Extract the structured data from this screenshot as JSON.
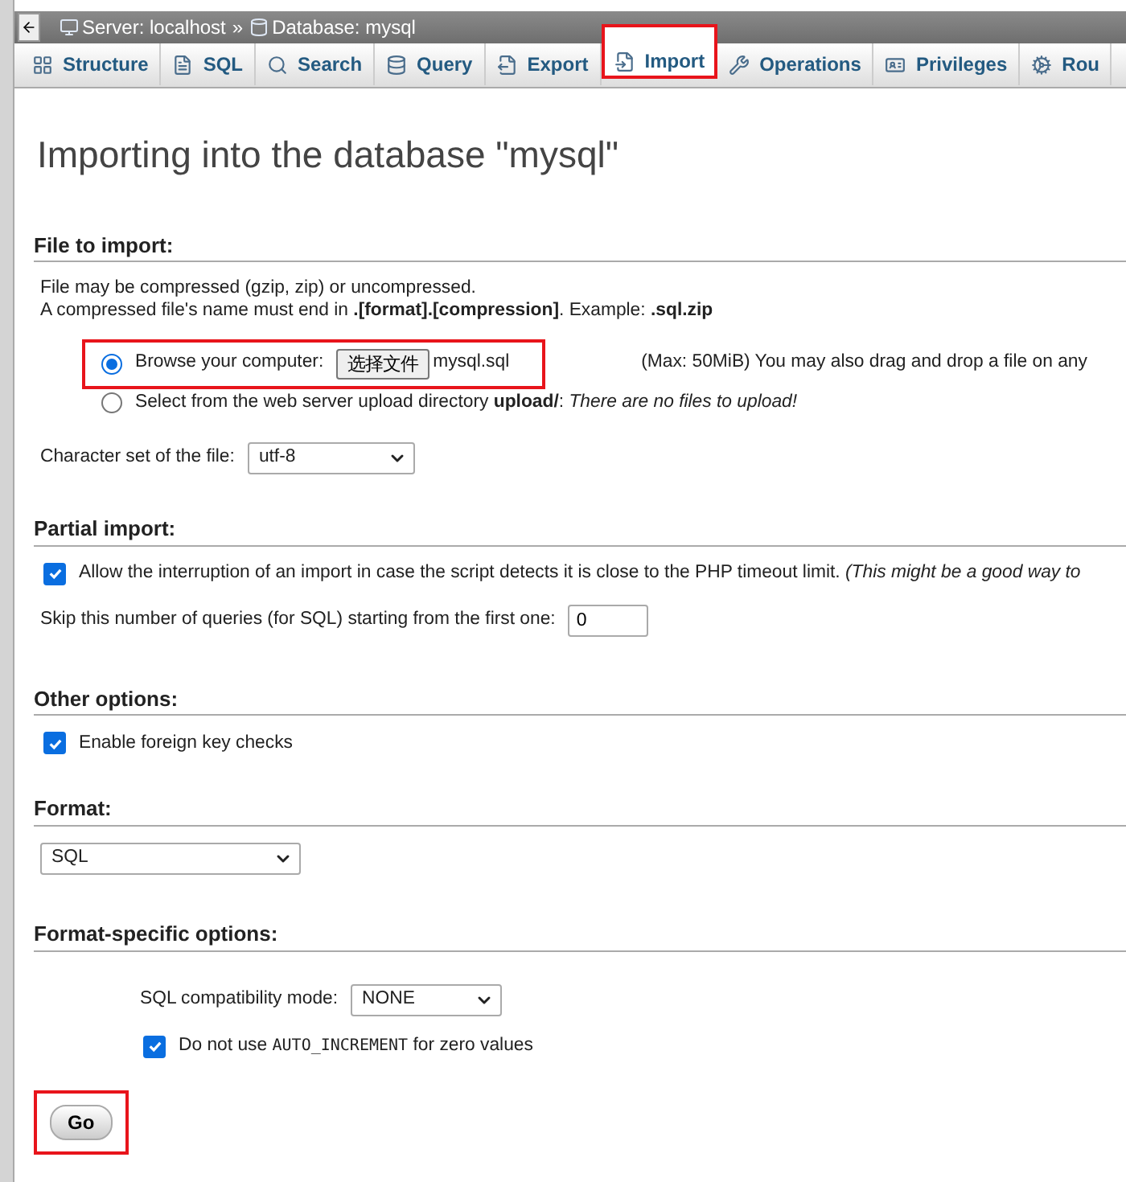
{
  "breadcrumb": [
    {
      "label": "Server: localhost",
      "kind": "server"
    },
    {
      "label": "Database: mysql",
      "kind": "database"
    }
  ],
  "breadcrumb_separator": "»",
  "tabs": [
    {
      "label": "Structure",
      "selected": false,
      "highlighted": false
    },
    {
      "label": "SQL",
      "selected": false,
      "highlighted": false
    },
    {
      "label": "Search",
      "selected": false,
      "highlighted": false
    },
    {
      "label": "Query",
      "selected": false,
      "highlighted": false
    },
    {
      "label": "Export",
      "selected": false,
      "highlighted": false
    },
    {
      "label": "Import",
      "selected": true,
      "highlighted": true
    },
    {
      "label": "Operations",
      "selected": false,
      "highlighted": false
    },
    {
      "label": "Privileges",
      "selected": false,
      "highlighted": false
    },
    {
      "label": "Rou",
      "selected": false,
      "highlighted": false
    }
  ],
  "title": "Importing into the database \"mysql\"",
  "file_section": {
    "heading": "File to import:",
    "notes": [
      "File may be compressed (gzip, zip) or uncompressed.",
      "A compressed file's name must end in **.[format].[compression]**. Example: **.sql.zip**"
    ],
    "sources": [
      {
        "label": "Browse your computer:",
        "selected": true,
        "highlighted": true,
        "button": "选择文件",
        "file": "mysql.sql",
        "hint": "(Max: 50MiB) You may also drag and drop a file on any"
      },
      {
        "label": "Select from the web server upload directory **upload/**: *There are no files to upload!*",
        "selected": false,
        "highlighted": false
      }
    ],
    "charset": {
      "label": "Character set of the file:",
      "value": "utf-8"
    }
  },
  "partial_section": {
    "heading": "Partial import:",
    "allow_interrupt": {
      "label": "Allow the interruption of an import in case the script detects it is close to the PHP timeout limit. *(This might be a good way to*",
      "checked": true
    },
    "skip": {
      "label": "Skip this number of queries (for SQL) starting from the first one:",
      "value": "0"
    }
  },
  "other_section": {
    "heading": "Other options:",
    "foreign_keys": {
      "label": "Enable foreign key checks",
      "checked": true
    }
  },
  "format_section": {
    "heading": "Format:",
    "value": "SQL"
  },
  "specific_section": {
    "heading": "Format-specific options:",
    "compat": {
      "label": "SQL compatibility mode:",
      "value": "NONE"
    },
    "auto_increment": {
      "before": "Do not use",
      "code": "AUTO_INCREMENT",
      "after": "for zero values",
      "checked": true
    }
  },
  "go": {
    "label": "Go",
    "highlighted": true
  }
}
